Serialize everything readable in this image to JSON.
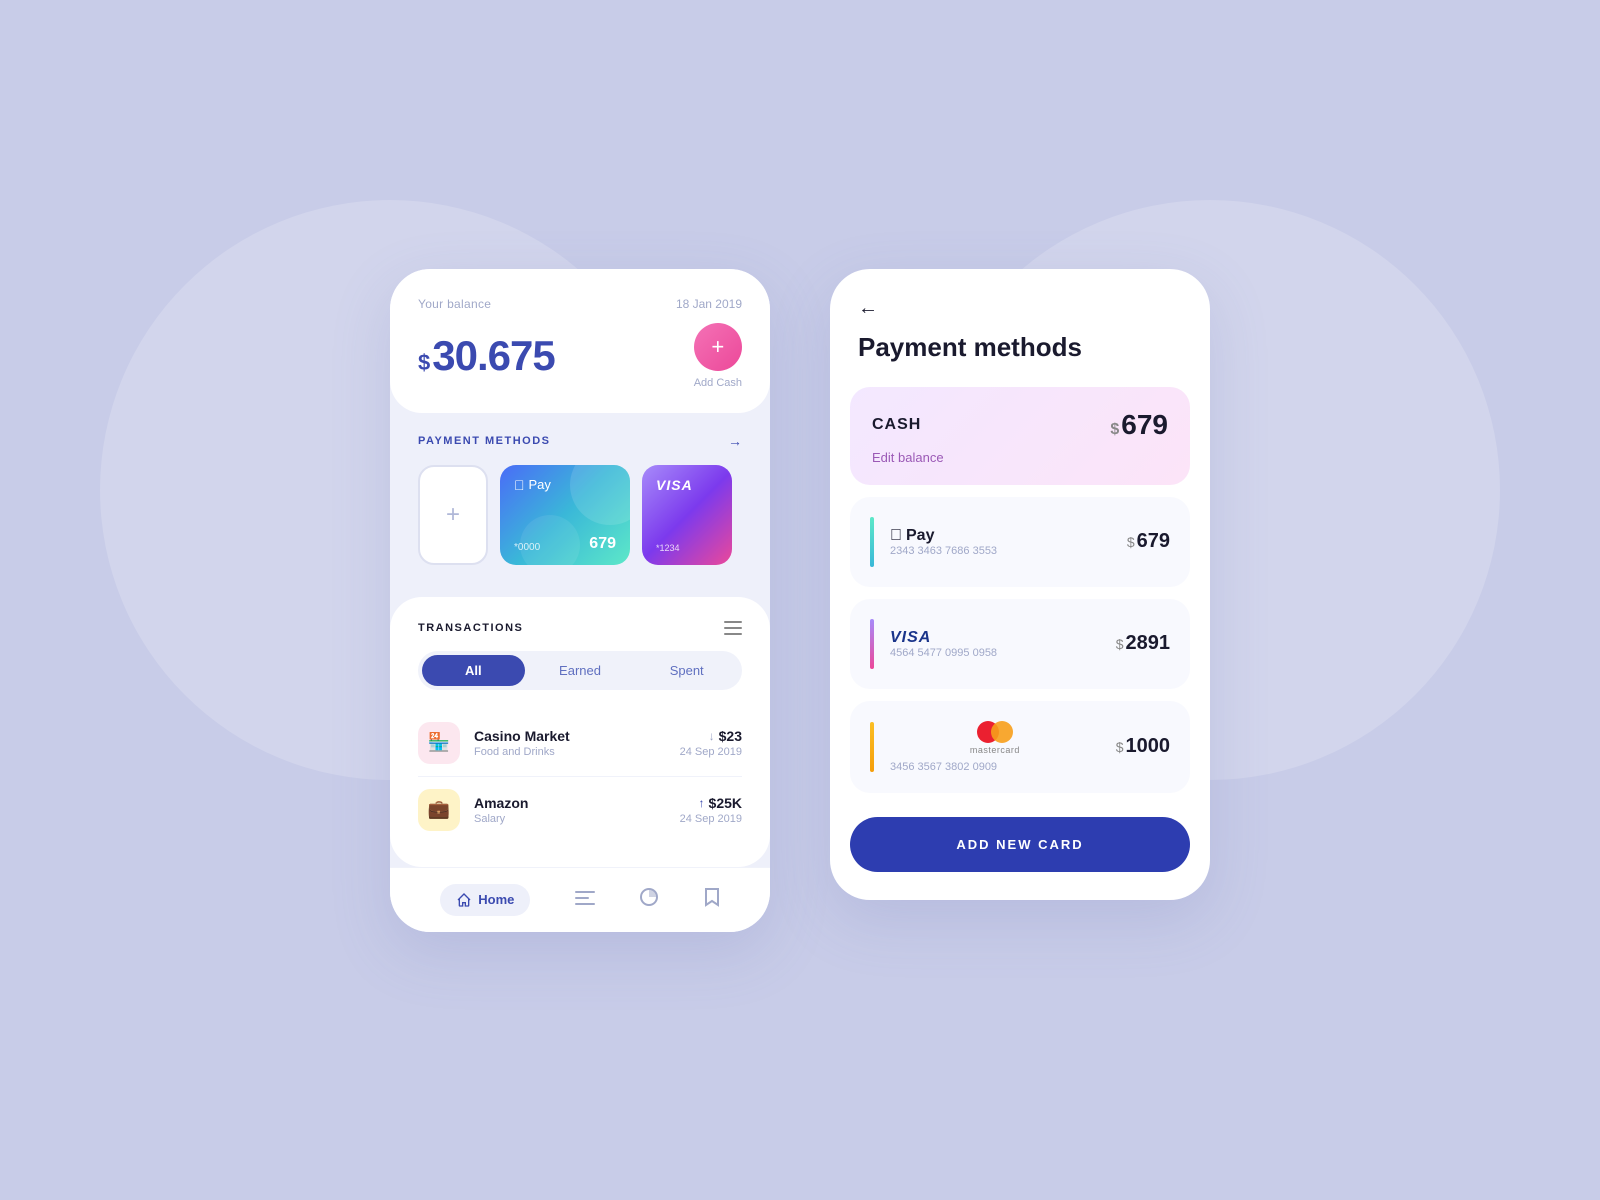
{
  "background": {
    "color": "#c8cce8"
  },
  "left_phone": {
    "balance_label": "Your balance",
    "balance_date": "18 Jan 2019",
    "balance_amount": "30.675",
    "balance_dollar": "$",
    "add_cash_label": "Add Cash",
    "payment_methods_title": "PAYMENT METHODS",
    "cards": [
      {
        "type": "applepay",
        "number": "*0000",
        "balance": "679"
      },
      {
        "type": "visa",
        "number": "*1234"
      }
    ],
    "transactions_title": "TRANSACTIONS",
    "filter_tabs": [
      "All",
      "Earned",
      "Spent"
    ],
    "active_tab": "All",
    "transactions": [
      {
        "name": "Casino Market",
        "category": "Food and Drinks",
        "amount": "$23",
        "direction": "down",
        "date": "24 Sep 2019"
      },
      {
        "name": "Amazon",
        "category": "Salary",
        "amount": "$25K",
        "direction": "up",
        "date": "24 Sep 2019"
      }
    ],
    "nav": {
      "home_label": "Home",
      "items": [
        "home",
        "menu",
        "chart",
        "bookmark"
      ]
    }
  },
  "right_phone": {
    "back_arrow": "←",
    "page_title": "Payment methods",
    "cash_card": {
      "label": "CASH",
      "dollar": "$",
      "amount": "679",
      "edit_label": "Edit balance"
    },
    "payment_items": [
      {
        "type": "applepay",
        "brand": "Pay",
        "number": "2343 3463 7686 3553",
        "dollar": "$",
        "amount": "679",
        "bar_color": "bar-cyan"
      },
      {
        "type": "visa",
        "brand": "VISA",
        "number": "4564 5477 0995 0958",
        "dollar": "$",
        "amount": "2891",
        "bar_color": "bar-purple"
      },
      {
        "type": "mastercard",
        "brand": "mastercard",
        "number": "3456 3567 3802 0909",
        "dollar": "$",
        "amount": "1000",
        "bar_color": "bar-orange"
      }
    ],
    "add_new_card_label": "ADD NEW CARD"
  }
}
